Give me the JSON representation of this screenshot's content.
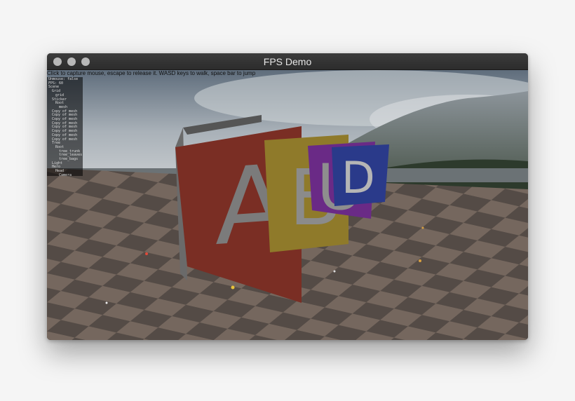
{
  "window": {
    "title": "FPS Demo"
  },
  "hud": {
    "instructions": "Click to capture mouse, escape to release it. WASD keys to walk, space bar to jump"
  },
  "scene_tree": [
    {
      "label": "Unmouse: false",
      "depth": 0
    },
    {
      "label": "FPS: 60",
      "depth": 0
    },
    {
      "label": "Scene",
      "depth": 0
    },
    {
      "label": "Grid",
      "depth": 1
    },
    {
      "label": "grid",
      "depth": 2
    },
    {
      "label": "Sticker",
      "depth": 1
    },
    {
      "label": "Root",
      "depth": 2
    },
    {
      "label": "mesh",
      "depth": 3
    },
    {
      "label": "Copy of mesh",
      "depth": 1
    },
    {
      "label": "Copy of mesh",
      "depth": 1
    },
    {
      "label": "Copy of mesh",
      "depth": 1
    },
    {
      "label": "Copy of mesh",
      "depth": 1
    },
    {
      "label": "Copy of mesh",
      "depth": 1
    },
    {
      "label": "Copy of mesh",
      "depth": 1
    },
    {
      "label": "Copy of mesh",
      "depth": 1
    },
    {
      "label": "Copy of mesh",
      "depth": 1
    },
    {
      "label": "Tree",
      "depth": 1
    },
    {
      "label": "Root",
      "depth": 2
    },
    {
      "label": "tree_trunk",
      "depth": 3
    },
    {
      "label": "tree_leaves",
      "depth": 3
    },
    {
      "label": "tree_bags",
      "depth": 3
    },
    {
      "label": "Light",
      "depth": 1
    },
    {
      "label": "Hero",
      "depth": 1
    },
    {
      "label": "Head",
      "depth": 2
    },
    {
      "label": "Camera",
      "depth": 3
    }
  ],
  "blocks": [
    {
      "letter": "A",
      "color": "#7a2e24"
    },
    {
      "letter": "B",
      "color": "#8f7a2a"
    },
    {
      "letter": "C",
      "color": "#6a2a86"
    },
    {
      "letter": "D",
      "color": "#2a3a8a"
    }
  ],
  "colors": {
    "floor_light": "#7f7066",
    "floor_dark": "#5c524c",
    "sky_top": "#6d7b8a",
    "sky_bottom": "#c3c8cc"
  }
}
